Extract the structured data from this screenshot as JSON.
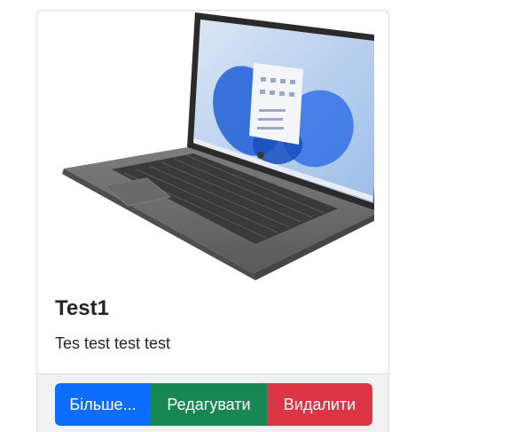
{
  "card": {
    "title": "Test1",
    "description": "Tes test test test",
    "image_subject": "laptop-product-photo"
  },
  "buttons": {
    "more_label": "Більше...",
    "edit_label": "Редагувати",
    "delete_label": "Видалити"
  },
  "colors": {
    "more": "#0d6efd",
    "edit": "#198754",
    "delete": "#dc3545",
    "footer_bg": "#f1f1f1"
  }
}
